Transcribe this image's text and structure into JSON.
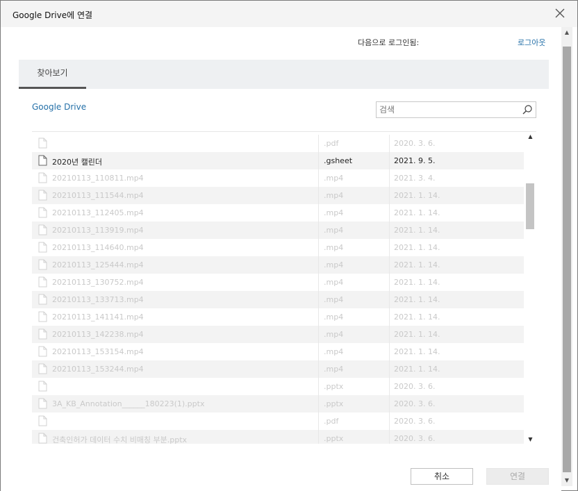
{
  "window": {
    "title": "Google Drive에 연결"
  },
  "account": {
    "login_label": "다음으로 로그인됨:",
    "logout_label": "로그아웃"
  },
  "tabs": [
    {
      "label": "찾아보기",
      "active": true
    }
  ],
  "breadcrumb": {
    "label": "Google Drive"
  },
  "search": {
    "placeholder": "검색",
    "value": ""
  },
  "files": [
    {
      "name": "",
      "ext": ".pdf",
      "date": "2020. 3. 6.",
      "enabled": false
    },
    {
      "name": "2020년 캘린더",
      "ext": ".gsheet",
      "date": "2021. 9. 5.",
      "enabled": true
    },
    {
      "name": "20210113_110811.mp4",
      "ext": ".mp4",
      "date": "2021. 3. 4.",
      "enabled": false
    },
    {
      "name": "20210113_111544.mp4",
      "ext": ".mp4",
      "date": "2021. 1. 14.",
      "enabled": false
    },
    {
      "name": "20210113_112405.mp4",
      "ext": ".mp4",
      "date": "2021. 1. 14.",
      "enabled": false
    },
    {
      "name": "20210113_113919.mp4",
      "ext": ".mp4",
      "date": "2021. 1. 14.",
      "enabled": false
    },
    {
      "name": "20210113_114640.mp4",
      "ext": ".mp4",
      "date": "2021. 1. 14.",
      "enabled": false
    },
    {
      "name": "20210113_125444.mp4",
      "ext": ".mp4",
      "date": "2021. 1. 14.",
      "enabled": false
    },
    {
      "name": "20210113_130752.mp4",
      "ext": ".mp4",
      "date": "2021. 1. 14.",
      "enabled": false
    },
    {
      "name": "20210113_133713.mp4",
      "ext": ".mp4",
      "date": "2021. 1. 14.",
      "enabled": false
    },
    {
      "name": "20210113_141141.mp4",
      "ext": ".mp4",
      "date": "2021. 1. 14.",
      "enabled": false
    },
    {
      "name": "20210113_142238.mp4",
      "ext": ".mp4",
      "date": "2021. 1. 14.",
      "enabled": false
    },
    {
      "name": "20210113_153154.mp4",
      "ext": ".mp4",
      "date": "2021. 1. 14.",
      "enabled": false
    },
    {
      "name": "20210113_153244.mp4",
      "ext": ".mp4",
      "date": "2021. 1. 14.",
      "enabled": false
    },
    {
      "name": "",
      "ext": ".pptx",
      "date": "2020. 3. 6.",
      "enabled": false
    },
    {
      "name": "3A_KB_Annotation______180223(1).pptx",
      "ext": ".pptx",
      "date": "2020. 3. 6.",
      "enabled": false
    },
    {
      "name": "",
      "ext": ".pdf",
      "date": "2020. 3. 6.",
      "enabled": false
    },
    {
      "name": "건축인허가 데이터 수치 비매칭 부분.pptx",
      "ext": ".pptx",
      "date": "2020. 3. 6.",
      "enabled": false
    }
  ],
  "buttons": {
    "cancel_label": "취소",
    "connect_label": "연결"
  },
  "icons": {
    "close": "close-icon",
    "search": "search-icon",
    "file": "file-icon",
    "scroll_up": "scroll-up-arrow",
    "scroll_down": "scroll-down-arrow"
  },
  "colors": {
    "link": "#2470a8",
    "row_alt": "#f3f3f3",
    "disabled_text": "#c9c9c9"
  }
}
